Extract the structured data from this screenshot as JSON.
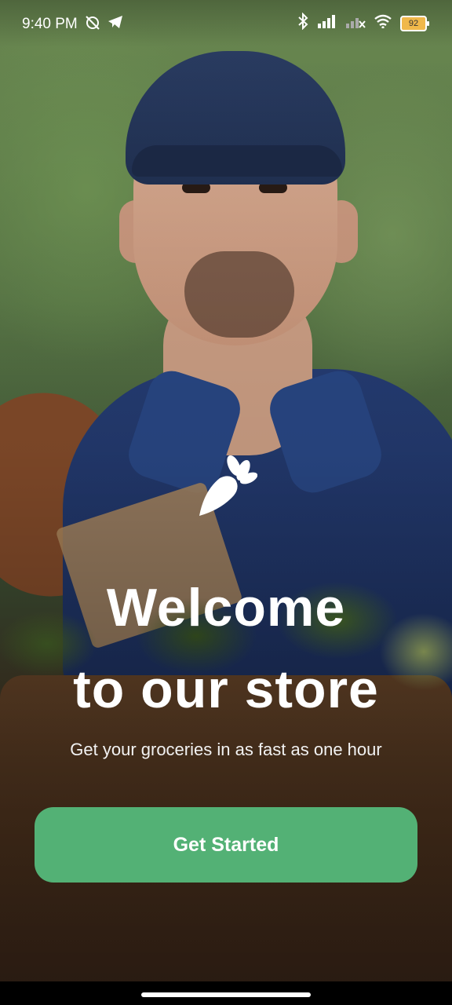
{
  "status_bar": {
    "time": "9:40 PM",
    "battery": "92",
    "icons": [
      "alarm-off-icon",
      "telegram-icon",
      "bluetooth-icon",
      "signal-icon",
      "signal-no-service-icon",
      "wifi-icon",
      "battery-icon"
    ]
  },
  "background": {
    "image": "delivery-person-holding-grocery-bag"
  },
  "brand": {
    "icon": "carrot-icon",
    "accent": "#53B175"
  },
  "welcome": {
    "line1": "Welcome",
    "line2": "to our store",
    "subtitle": "Get your groceries in as fast as one hour"
  },
  "cta": {
    "label": "Get Started"
  }
}
